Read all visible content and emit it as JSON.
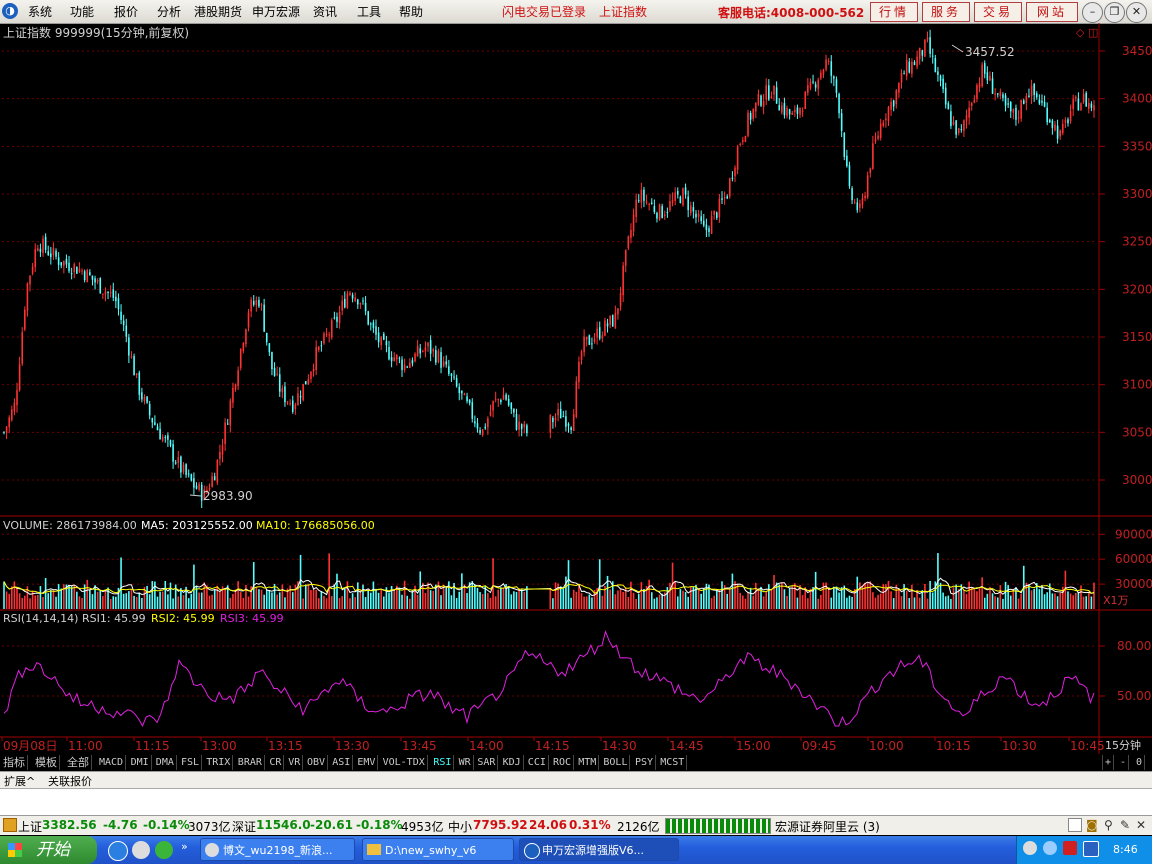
{
  "menubar": {
    "items": [
      "系统",
      "功能",
      "报价",
      "分析",
      "港股期货",
      "申万宏源",
      "资讯",
      "工具",
      "帮助"
    ],
    "status_flash": "闪电交易已登录",
    "status_index": "上证指数",
    "hotline": "客服电话:4008-000-562",
    "buttons": [
      "行情",
      "服务",
      "交易",
      "网站"
    ]
  },
  "chart": {
    "title": "上证指数 999999(15分钟,前复权)",
    "high_label": "3457.52",
    "low_label": "2983.90",
    "price_ticks": [
      "3450",
      "3400",
      "3350",
      "3300",
      "3250",
      "3200",
      "3150",
      "3100",
      "3050",
      "3000"
    ],
    "volume_label": "VOLUME: 286173984.00",
    "ma5_label": "MA5: 203125552.00",
    "ma10_label": "MA10: 176685056.00",
    "volume_ticks": [
      "90000",
      "60000",
      "30000"
    ],
    "volume_unit": "X1万",
    "rsi_prefix": "RSI(14,14,14)",
    "rsi1_label": "RSI1: 45.99",
    "rsi2_label": "RSI2: 45.99",
    "rsi3_label": "RSI3: 45.99",
    "rsi_ticks": [
      "80.00",
      "50.00"
    ],
    "time_labels": [
      "09月08日",
      "11:00",
      "11:15",
      "13:00",
      "13:15",
      "13:30",
      "13:45",
      "14:00",
      "14:15",
      "14:30",
      "14:45",
      "15:00",
      "09:45",
      "10:00",
      "10:15",
      "10:30",
      "10:45"
    ],
    "period": "15分钟"
  },
  "indicator_tabs": [
    "指标",
    "模板",
    "全部",
    "MACD",
    "DMI",
    "DMA",
    "FSL",
    "TRIX",
    "BRAR",
    "CR",
    "VR",
    "OBV",
    "ASI",
    "EMV",
    "VOL-TDX",
    "RSI",
    "WR",
    "SAR",
    "KDJ",
    "CCI",
    "ROC",
    "MTM",
    "BOLL",
    "PSY",
    "MCST"
  ],
  "indicator_active": "RSI",
  "indicator_ctrl": [
    "+",
    "-",
    "0"
  ],
  "expand": {
    "left": "扩展^",
    "right": "关联报价"
  },
  "status": {
    "sh_name": "上证",
    "sh_price": "3382.56",
    "sh_change": "-4.76",
    "sh_pct": "-0.14%",
    "sh_amount": "3073亿",
    "sz_name": "深证",
    "sz_price": "11546.0",
    "sz_change": "-20.61",
    "sz_pct": "-0.18%",
    "sz_amount": "4953亿",
    "zx_name": "中小",
    "zx_price": "7795.92",
    "zx_change": "24.06",
    "zx_pct": "0.31%",
    "zx_amount": "2126亿",
    "broker": "宏源证券阿里云 (3)"
  },
  "taskbar": {
    "start": "开始",
    "tasks": [
      "博文_wu2198_新浪...",
      "D:\\new_swhy_v6",
      "申万宏源增强版V6..."
    ],
    "clock": "8:46"
  },
  "colors": {
    "up": "#ff3333",
    "down": "#54ffff",
    "rsi": "#e020e0",
    "ma5": "#ffffff",
    "ma10": "#ffff00",
    "axis": "#a00000"
  },
  "chart_data": {
    "type": "candlestick",
    "title": "上证指数 999999(15分钟,前复权)",
    "ylim": [
      2970,
      3470
    ],
    "high": 3457.52,
    "low": 2983.9,
    "close_path": [
      3050,
      3080,
      3200,
      3250,
      3240,
      3230,
      3225,
      3220,
      3210,
      3200,
      3190,
      3150,
      3100,
      3070,
      3050,
      3030,
      3010,
      2995,
      2984,
      3010,
      3060,
      3120,
      3180,
      3190,
      3120,
      3090,
      3080,
      3100,
      3130,
      3150,
      3170,
      3200,
      3190,
      3160,
      3140,
      3130,
      3120,
      3130,
      3140,
      3130,
      3110,
      3090,
      3070,
      3050,
      3080,
      3090,
      3060,
      3050,
      3040,
      3060,
      3070,
      3060,
      3140,
      3150,
      3160,
      3170,
      3240,
      3300,
      3290,
      3280,
      3290,
      3300,
      3280,
      3260,
      3280,
      3300,
      3350,
      3380,
      3400,
      3410,
      3390,
      3380,
      3400,
      3420,
      3440,
      3400,
      3300,
      3280,
      3340,
      3380,
      3400,
      3430,
      3440,
      3457,
      3420,
      3380,
      3360,
      3400,
      3430,
      3410,
      3390,
      3380,
      3410,
      3400,
      3380,
      3360,
      3390,
      3400,
      3390
    ],
    "volume_ylim": [
      0,
      100000
    ],
    "volume_unit": "X1万",
    "rsi_ylim": [
      30,
      100
    ],
    "rsi_path": [
      40,
      58,
      70,
      68,
      62,
      55,
      48,
      45,
      44,
      42,
      40,
      38,
      35,
      35,
      45,
      70,
      62,
      55,
      50,
      48,
      50,
      55,
      65,
      58,
      52,
      46,
      42,
      48,
      55,
      60,
      52,
      45,
      42,
      40,
      44,
      48,
      50,
      52,
      45,
      40,
      38,
      42,
      48,
      55,
      62,
      75,
      72,
      68,
      65,
      68,
      73,
      80,
      86,
      78,
      70,
      65,
      62,
      58,
      55,
      50,
      48,
      52,
      58,
      68,
      72,
      70,
      66,
      62,
      58,
      52,
      45,
      40,
      32,
      38,
      45,
      55,
      62,
      66,
      70,
      72,
      60,
      50,
      42,
      38,
      48,
      55,
      62,
      58,
      50,
      45,
      48,
      55,
      60,
      55,
      48
    ],
    "time_labels": [
      "09月08日",
      "11:00",
      "11:15",
      "13:00",
      "13:15",
      "13:30",
      "13:45",
      "14:00",
      "14:15",
      "14:30",
      "14:45",
      "15:00",
      "09:45",
      "10:00",
      "10:15",
      "10:30",
      "10:45"
    ]
  }
}
